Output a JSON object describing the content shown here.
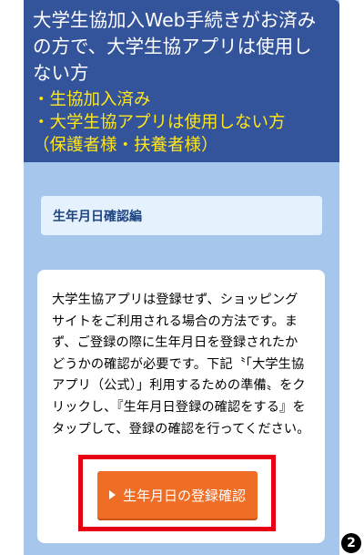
{
  "header": {
    "title": "大学生協加入Web手続きがお済みの方で、大学生協アプリは使用しない方",
    "points": [
      "・生協加入済み",
      "・大学生協アプリは使用しない方",
      "（保護者様・扶養者様）"
    ]
  },
  "section": {
    "label": "生年月日確認編"
  },
  "content": {
    "body": "大学生協アプリは登録せず、ショッピングサイトをご利用される場合の方法です。まず、ご登録の際に生年月日を登録されたかどうかの確認が必要です。下記〝「大学生協アプリ（公式）」利用するための準備〟をクリックし、『生年月日登録の確認をする』をタップして、登録の確認を行ってください。",
    "button_label": "生年月日の登録確認"
  },
  "badge": {
    "number": "2"
  },
  "colors": {
    "header_bg": "#33539a",
    "header_point": "#ffe61a",
    "card_bg": "#a7c6ec",
    "section_bg": "#e5f1fc",
    "button": "#ef6d25",
    "highlight": "#e60012"
  }
}
